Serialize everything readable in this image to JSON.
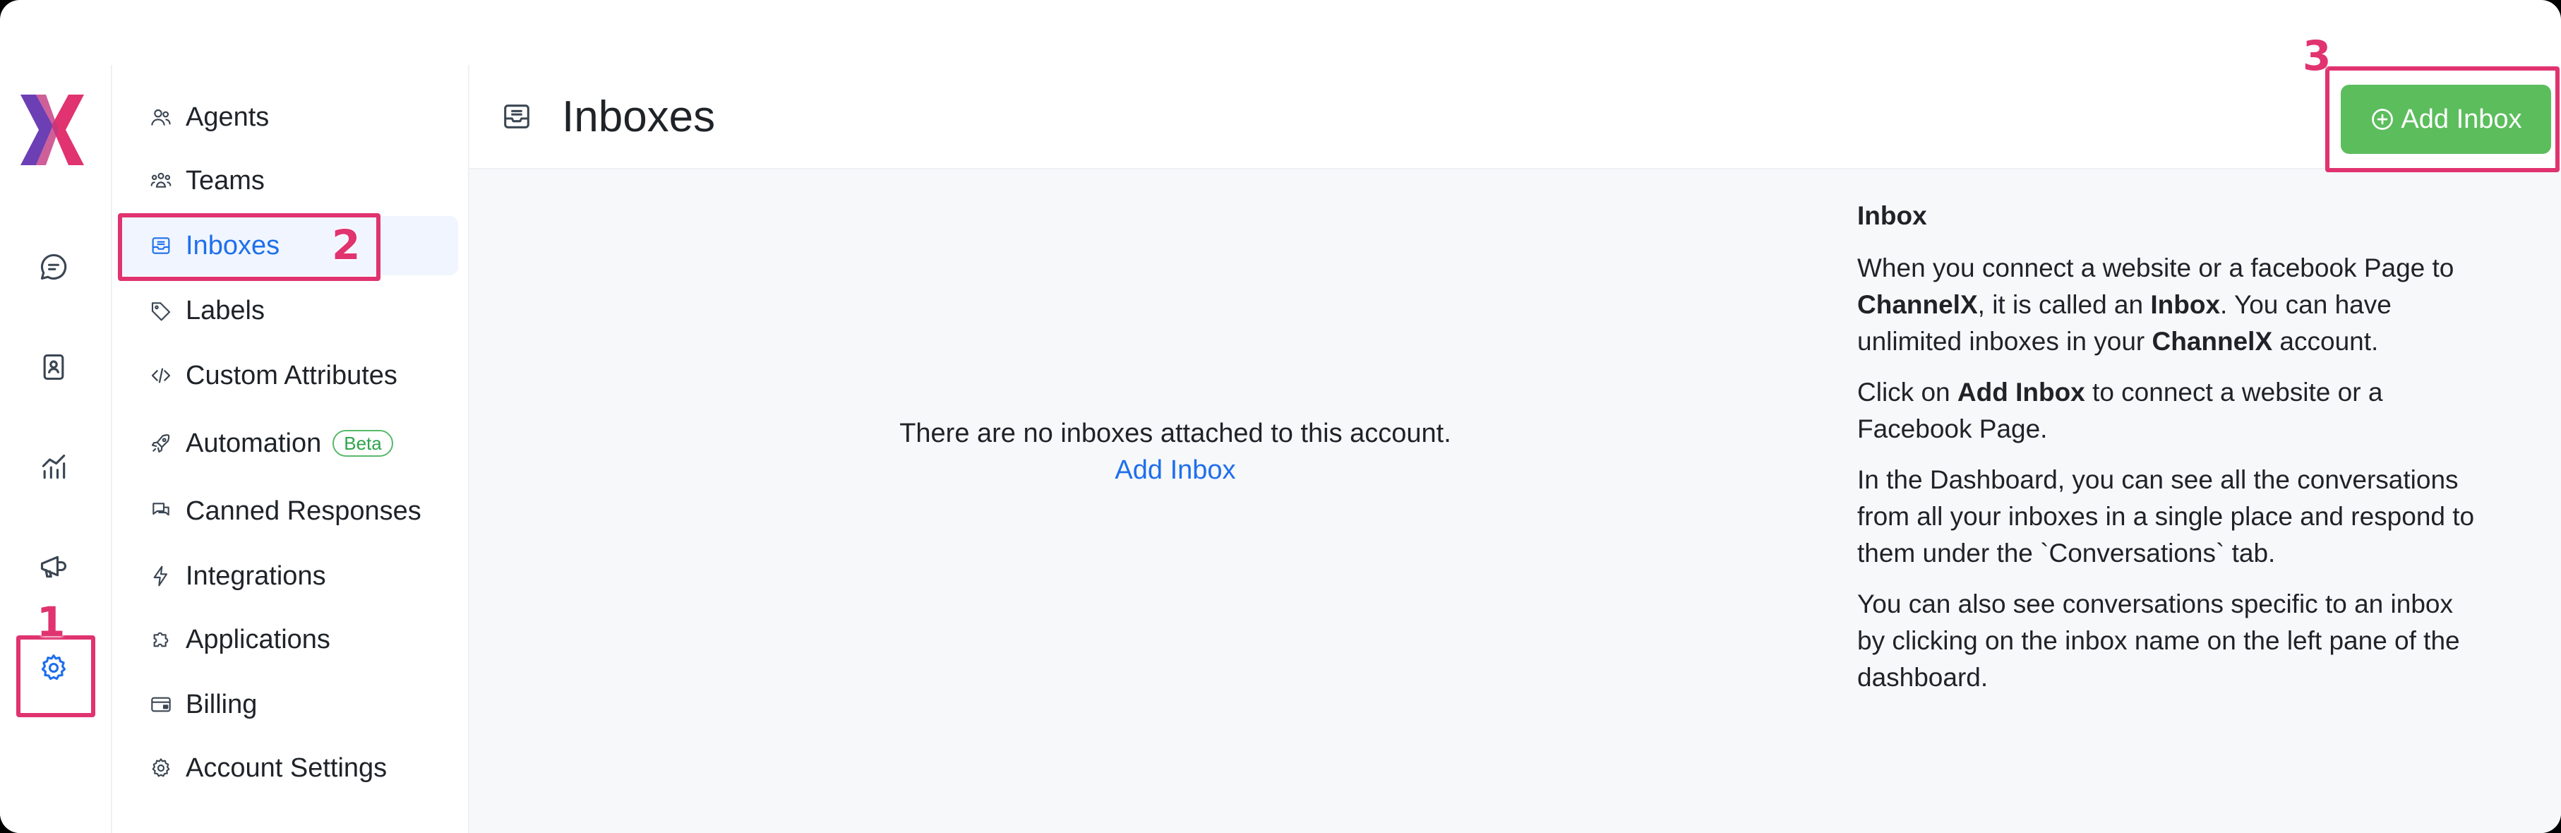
{
  "rail": {
    "items": [
      {
        "name": "conversations",
        "icon": "chat-bubble-icon"
      },
      {
        "name": "contacts",
        "icon": "contact-book-icon"
      },
      {
        "name": "reports",
        "icon": "chart-icon"
      },
      {
        "name": "campaigns",
        "icon": "megaphone-icon"
      },
      {
        "name": "settings",
        "icon": "gear-icon",
        "active": true
      }
    ]
  },
  "settings_nav": {
    "items": [
      {
        "label": "Agents",
        "icon": "people-icon"
      },
      {
        "label": "Teams",
        "icon": "team-icon"
      },
      {
        "label": "Inboxes",
        "icon": "inbox-icon",
        "active": true
      },
      {
        "label": "Labels",
        "icon": "tag-icon"
      },
      {
        "label": "Custom Attributes",
        "icon": "code-icon"
      },
      {
        "label": "Automation",
        "icon": "rocket-icon",
        "badge": "Beta"
      },
      {
        "label": "Canned Responses",
        "icon": "chat-multiple-icon"
      },
      {
        "label": "Integrations",
        "icon": "flash-icon"
      },
      {
        "label": "Applications",
        "icon": "puzzle-icon"
      },
      {
        "label": "Billing",
        "icon": "credit-card-icon"
      },
      {
        "label": "Account Settings",
        "icon": "gear-icon"
      }
    ]
  },
  "header": {
    "title": "Inboxes",
    "add_button_label": "Add Inbox"
  },
  "empty_state": {
    "message": "There are no inboxes attached to this account.",
    "link_label": "Add Inbox"
  },
  "help": {
    "heading": "Inbox",
    "p1": {
      "t1": "When you connect a website or a facebook Page to ",
      "b1": "ChannelX",
      "t2": ", it is called an ",
      "b2": "Inbox",
      "t3": ". You can have unlimited inboxes in your ",
      "b3": "ChannelX",
      "t4": " account."
    },
    "p2": {
      "t1": "Click on ",
      "b1": "Add Inbox",
      "t2": " to connect a website or a Facebook Page."
    },
    "p3": "In the Dashboard, you can see all the conversations from all your inboxes in a single place and respond to them under the `Conversations` tab.",
    "p4": "You can also see conversations specific to an inbox by clicking on the inbox name on the left pane of the dashboard."
  },
  "annotations": {
    "step1": "1",
    "step2": "2",
    "step3": "3"
  },
  "colors": {
    "accent": "#1f6feb",
    "primary_button": "#5cbd5c",
    "annotation": "#e0336f",
    "logo_left": "#e0336f",
    "logo_right": "#6c3fb5"
  }
}
